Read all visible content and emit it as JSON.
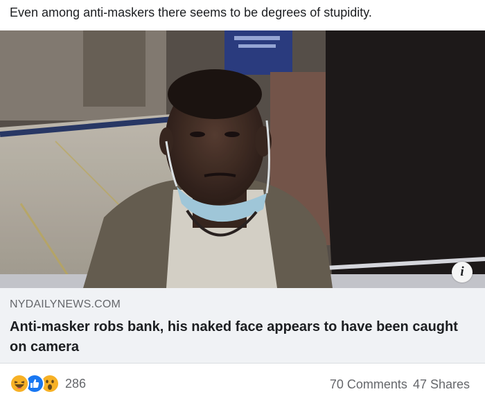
{
  "post": {
    "caption": "Even among anti-maskers there seems to be degrees of stupidity."
  },
  "link": {
    "domain": "NYDAILYNEWS.COM",
    "headline": "Anti-masker robs bank, his naked face appears to have been caught on camera",
    "info_icon": "info-icon"
  },
  "footer": {
    "reaction_icons": [
      "haha-icon",
      "like-icon",
      "wow-icon"
    ],
    "reaction_count": "286",
    "comments": "70 Comments",
    "shares": "47 Shares"
  },
  "colors": {
    "like_blue": "#1877f2",
    "reaction_yellow": "#f7b125",
    "secondary_text": "#65676b",
    "link_bg": "#f0f2f5"
  }
}
